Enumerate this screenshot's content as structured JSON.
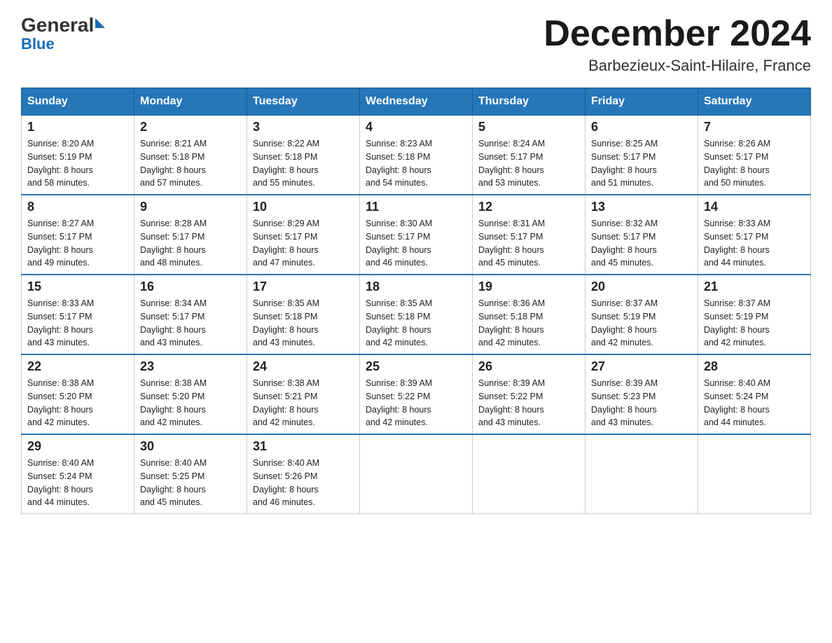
{
  "logo": {
    "general": "General",
    "blue": "Blue"
  },
  "title": "December 2024",
  "subtitle": "Barbezieux-Saint-Hilaire, France",
  "days_header": [
    "Sunday",
    "Monday",
    "Tuesday",
    "Wednesday",
    "Thursday",
    "Friday",
    "Saturday"
  ],
  "weeks": [
    [
      {
        "day": "1",
        "sunrise": "8:20 AM",
        "sunset": "5:19 PM",
        "daylight": "8 hours and 58 minutes."
      },
      {
        "day": "2",
        "sunrise": "8:21 AM",
        "sunset": "5:18 PM",
        "daylight": "8 hours and 57 minutes."
      },
      {
        "day": "3",
        "sunrise": "8:22 AM",
        "sunset": "5:18 PM",
        "daylight": "8 hours and 55 minutes."
      },
      {
        "day": "4",
        "sunrise": "8:23 AM",
        "sunset": "5:18 PM",
        "daylight": "8 hours and 54 minutes."
      },
      {
        "day": "5",
        "sunrise": "8:24 AM",
        "sunset": "5:17 PM",
        "daylight": "8 hours and 53 minutes."
      },
      {
        "day": "6",
        "sunrise": "8:25 AM",
        "sunset": "5:17 PM",
        "daylight": "8 hours and 51 minutes."
      },
      {
        "day": "7",
        "sunrise": "8:26 AM",
        "sunset": "5:17 PM",
        "daylight": "8 hours and 50 minutes."
      }
    ],
    [
      {
        "day": "8",
        "sunrise": "8:27 AM",
        "sunset": "5:17 PM",
        "daylight": "8 hours and 49 minutes."
      },
      {
        "day": "9",
        "sunrise": "8:28 AM",
        "sunset": "5:17 PM",
        "daylight": "8 hours and 48 minutes."
      },
      {
        "day": "10",
        "sunrise": "8:29 AM",
        "sunset": "5:17 PM",
        "daylight": "8 hours and 47 minutes."
      },
      {
        "day": "11",
        "sunrise": "8:30 AM",
        "sunset": "5:17 PM",
        "daylight": "8 hours and 46 minutes."
      },
      {
        "day": "12",
        "sunrise": "8:31 AM",
        "sunset": "5:17 PM",
        "daylight": "8 hours and 45 minutes."
      },
      {
        "day": "13",
        "sunrise": "8:32 AM",
        "sunset": "5:17 PM",
        "daylight": "8 hours and 45 minutes."
      },
      {
        "day": "14",
        "sunrise": "8:33 AM",
        "sunset": "5:17 PM",
        "daylight": "8 hours and 44 minutes."
      }
    ],
    [
      {
        "day": "15",
        "sunrise": "8:33 AM",
        "sunset": "5:17 PM",
        "daylight": "8 hours and 43 minutes."
      },
      {
        "day": "16",
        "sunrise": "8:34 AM",
        "sunset": "5:17 PM",
        "daylight": "8 hours and 43 minutes."
      },
      {
        "day": "17",
        "sunrise": "8:35 AM",
        "sunset": "5:18 PM",
        "daylight": "8 hours and 43 minutes."
      },
      {
        "day": "18",
        "sunrise": "8:35 AM",
        "sunset": "5:18 PM",
        "daylight": "8 hours and 42 minutes."
      },
      {
        "day": "19",
        "sunrise": "8:36 AM",
        "sunset": "5:18 PM",
        "daylight": "8 hours and 42 minutes."
      },
      {
        "day": "20",
        "sunrise": "8:37 AM",
        "sunset": "5:19 PM",
        "daylight": "8 hours and 42 minutes."
      },
      {
        "day": "21",
        "sunrise": "8:37 AM",
        "sunset": "5:19 PM",
        "daylight": "8 hours and 42 minutes."
      }
    ],
    [
      {
        "day": "22",
        "sunrise": "8:38 AM",
        "sunset": "5:20 PM",
        "daylight": "8 hours and 42 minutes."
      },
      {
        "day": "23",
        "sunrise": "8:38 AM",
        "sunset": "5:20 PM",
        "daylight": "8 hours and 42 minutes."
      },
      {
        "day": "24",
        "sunrise": "8:38 AM",
        "sunset": "5:21 PM",
        "daylight": "8 hours and 42 minutes."
      },
      {
        "day": "25",
        "sunrise": "8:39 AM",
        "sunset": "5:22 PM",
        "daylight": "8 hours and 42 minutes."
      },
      {
        "day": "26",
        "sunrise": "8:39 AM",
        "sunset": "5:22 PM",
        "daylight": "8 hours and 43 minutes."
      },
      {
        "day": "27",
        "sunrise": "8:39 AM",
        "sunset": "5:23 PM",
        "daylight": "8 hours and 43 minutes."
      },
      {
        "day": "28",
        "sunrise": "8:40 AM",
        "sunset": "5:24 PM",
        "daylight": "8 hours and 44 minutes."
      }
    ],
    [
      {
        "day": "29",
        "sunrise": "8:40 AM",
        "sunset": "5:24 PM",
        "daylight": "8 hours and 44 minutes."
      },
      {
        "day": "30",
        "sunrise": "8:40 AM",
        "sunset": "5:25 PM",
        "daylight": "8 hours and 45 minutes."
      },
      {
        "day": "31",
        "sunrise": "8:40 AM",
        "sunset": "5:26 PM",
        "daylight": "8 hours and 46 minutes."
      },
      null,
      null,
      null,
      null
    ]
  ],
  "labels": {
    "sunrise": "Sunrise:",
    "sunset": "Sunset:",
    "daylight": "Daylight:"
  }
}
